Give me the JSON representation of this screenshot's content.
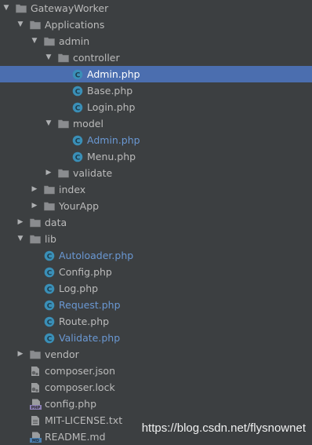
{
  "tree": [
    {
      "label": "GatewayWorker",
      "depth": 0,
      "kind": "folder",
      "expanded": true
    },
    {
      "label": "Applications",
      "depth": 1,
      "kind": "folder",
      "expanded": true
    },
    {
      "label": "admin",
      "depth": 2,
      "kind": "folder",
      "expanded": true
    },
    {
      "label": "controller",
      "depth": 3,
      "kind": "folder",
      "expanded": true
    },
    {
      "label": "Admin.php",
      "depth": 4,
      "kind": "class",
      "selected": true
    },
    {
      "label": "Base.php",
      "depth": 4,
      "kind": "class"
    },
    {
      "label": "Login.php",
      "depth": 4,
      "kind": "class"
    },
    {
      "label": "model",
      "depth": 3,
      "kind": "folder",
      "expanded": true
    },
    {
      "label": "Admin.php",
      "depth": 4,
      "kind": "class",
      "color": "blue"
    },
    {
      "label": "Menu.php",
      "depth": 4,
      "kind": "class"
    },
    {
      "label": "validate",
      "depth": 3,
      "kind": "folder",
      "expanded": false
    },
    {
      "label": "index",
      "depth": 2,
      "kind": "folder",
      "expanded": false
    },
    {
      "label": "YourApp",
      "depth": 2,
      "kind": "folder",
      "expanded": false
    },
    {
      "label": "data",
      "depth": 1,
      "kind": "folder",
      "expanded": false
    },
    {
      "label": "lib",
      "depth": 1,
      "kind": "folder",
      "expanded": true
    },
    {
      "label": "Autoloader.php",
      "depth": 2,
      "kind": "class",
      "color": "blue"
    },
    {
      "label": "Config.php",
      "depth": 2,
      "kind": "class"
    },
    {
      "label": "Log.php",
      "depth": 2,
      "kind": "class"
    },
    {
      "label": "Request.php",
      "depth": 2,
      "kind": "class",
      "color": "blue"
    },
    {
      "label": "Route.php",
      "depth": 2,
      "kind": "class"
    },
    {
      "label": "Validate.php",
      "depth": 2,
      "kind": "class",
      "color": "blue"
    },
    {
      "label": "vendor",
      "depth": 1,
      "kind": "folder",
      "expanded": false
    },
    {
      "label": "composer.json",
      "depth": 1,
      "kind": "json"
    },
    {
      "label": "composer.lock",
      "depth": 1,
      "kind": "json"
    },
    {
      "label": "config.php",
      "depth": 1,
      "kind": "php"
    },
    {
      "label": "MIT-LICENSE.txt",
      "depth": 1,
      "kind": "txt"
    },
    {
      "label": "README.md",
      "depth": 1,
      "kind": "md"
    }
  ],
  "watermark": "https://blog.csdn.net/flysnownet",
  "colors": {
    "background": "#3c3f41",
    "selection": "#4b6eaf",
    "text": "#bbbbbb",
    "modified": "#6a98d3",
    "class_icon": "#3a8fb7",
    "folder": "#8a8c8f"
  },
  "icons": {
    "folder": "folder-icon",
    "class": "php-class-icon",
    "json": "json-file-icon",
    "php": "php-file-icon",
    "txt": "text-file-icon",
    "md": "markdown-file-icon",
    "expanded": "chevron-down-icon",
    "collapsed": "chevron-right-icon"
  }
}
